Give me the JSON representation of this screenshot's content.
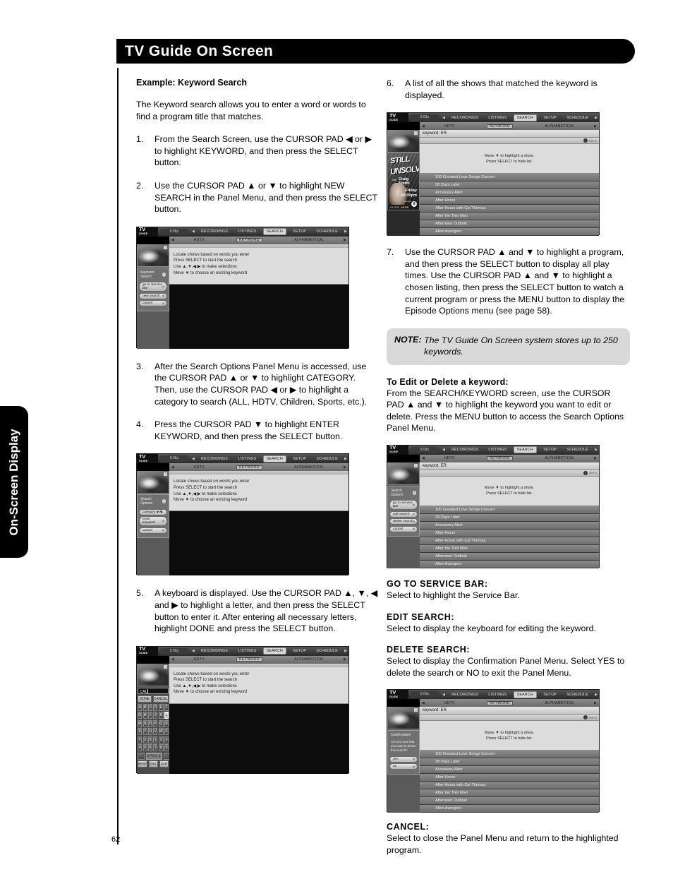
{
  "header": {
    "title": "TV Guide On Screen"
  },
  "side_tab": {
    "label": "On-Screen Display"
  },
  "page_number": "62",
  "left_column": {
    "heading": "Example: Keyword Search",
    "intro": "The Keyword search allows you to enter a word or words to find a program title that matches.",
    "steps": [
      {
        "num": "1.",
        "text": "From the Search Screen, use the CURSOR PAD ◀ or ▶ to highlight KEYWORD, and then press the SELECT button."
      },
      {
        "num": "2.",
        "text": "Use the CURSOR PAD ▲ or ▼ to highlight NEW SEARCH in the Panel Menu, and then press the SELECT button."
      },
      {
        "num": "3.",
        "text": "After the Search Options Panel Menu is accessed, use the CURSOR PAD ▲ or ▼ to highlight CATEGORY. Then, use the CURSOR PAD ◀ or ▶ to highlight a category to search (ALL, HDTV, Children, Sports, etc.)."
      },
      {
        "num": "4.",
        "text": "Press the CURSOR PAD ▼ to highlight ENTER KEYWORD, and then press the SELECT button."
      },
      {
        "num": "5.",
        "text": "A keyboard is displayed. Use the CURSOR PAD ▲, ▼, ◀ and ▶ to highlight a letter, and then press the SELECT button to enter it. After entering all necessary letters, highlight DONE and press the SELECT button."
      }
    ]
  },
  "right_column": {
    "steps": [
      {
        "num": "6.",
        "text": "A list of all the shows that matched the keyword is displayed."
      },
      {
        "num": "7.",
        "text": "Use the CURSOR PAD ▲ and ▼ to highlight a program, and then press the SELECT button to display all play times. Use the CURSOR PAD ▲ and ▼ to highlight a chosen listing, then press the SELECT button to watch a current program or press the MENU button to display the Episode Options menu (see page 58)."
      }
    ],
    "note": {
      "label": "NOTE:",
      "text": "The TV Guide On Screen system stores up to 250 keywords."
    },
    "edit_delete": {
      "heading": "To Edit or Delete a keyword:",
      "text": "From the SEARCH/KEYWORD screen, use the CURSOR PAD ▲ and ▼ to highlight the keyword you want to edit or delete. Press the MENU button to access the Search Options Panel Menu."
    },
    "definitions": [
      {
        "term": "GO TO SERVICE BAR:",
        "text": "Select to highlight the Service Bar."
      },
      {
        "term": "EDIT SEARCH:",
        "text": "Select to display the keyboard for editing the keyword."
      },
      {
        "term": "DELETE SEARCH:",
        "text": "Select to display the Confirmation Panel Menu. Select YES to delete the search or NO to exit the Panel Menu."
      },
      {
        "term": "CANCEL:",
        "text": "Select to close the Panel Menu and return to the highlighted program."
      }
    ]
  },
  "tvguide": {
    "logo": {
      "brand": "TV",
      "sub": "GUIDE"
    },
    "clock": "8:08p",
    "top_menu": [
      "RECORDINGS",
      "LISTINGS",
      "SEARCH",
      "SETUP",
      "SCHEDULE"
    ],
    "top_menu_active": "SEARCH",
    "sub_menu": [
      "HDTV",
      "KEYWORD",
      "ALPHABETICAL"
    ],
    "sub_menu_active": "KEYWORD",
    "instructions_search": [
      "Locate shows based on words you enter",
      "Press SELECT to start the search",
      "Use ▲,▼,◀,▶ to make selections",
      "Move ▼ to choose an existing keyword"
    ],
    "instructions_list": [
      "Move ▼ to highlight a show.",
      "Press SELECT to hide list."
    ],
    "keyword_bar": "keyword: ER",
    "info_label": "INFO",
    "show_list": [
      "100 Greatest Love Songs Concert",
      "28 Days Later",
      "Accessory Alert",
      "After Hours",
      "After Hours with Cal Thomas",
      "After the Thin Man",
      "Afternoon Outlook",
      "Alien Avengers"
    ],
    "advertisement": {
      "line1": "STILL",
      "line2": "UNSOLVED",
      "with": "with",
      "host": "Craig Smith",
      "day": "Friday",
      "time": "10:00pm",
      "connect": "Connect",
      "badge": "9",
      "click": "CLICK HERE"
    },
    "panel_keyword_search": {
      "title": "Keyword Search",
      "buttons": [
        "go to Service Bar",
        "new search",
        "cancel"
      ]
    },
    "panel_search_options_new": {
      "title": "Search Options",
      "category_label": "category",
      "category_value": "All",
      "buttons": [
        "enter keyword",
        "cancel"
      ]
    },
    "panel_search_options_edit": {
      "title": "Search Options",
      "buttons": [
        "go to Service Bar",
        "edit search",
        "delete search",
        "cancel"
      ]
    },
    "panel_confirmation": {
      "title": "Confirmation",
      "question": "Are you sure that you want to delete this search?",
      "buttons": [
        "yes",
        "no"
      ]
    },
    "keyboard": {
      "field_value": "CAL",
      "done": "DONE",
      "cancel": "CANCEL",
      "keys": [
        "A",
        "B",
        "C",
        "D",
        "E",
        "F",
        "G",
        "H",
        "I",
        "J",
        "K",
        "L",
        "M",
        "N",
        "O",
        "P",
        "Q",
        "R",
        "S",
        "T",
        "U",
        "V",
        "W",
        "X",
        "Y",
        "Z",
        "0",
        "1",
        "2",
        "3",
        "4",
        "5",
        "6",
        "7",
        "8",
        "9"
      ],
      "selected_key": "L",
      "space": "SPACE",
      "bottom": [
        "BKSP",
        "DEL",
        "CLR"
      ]
    }
  }
}
